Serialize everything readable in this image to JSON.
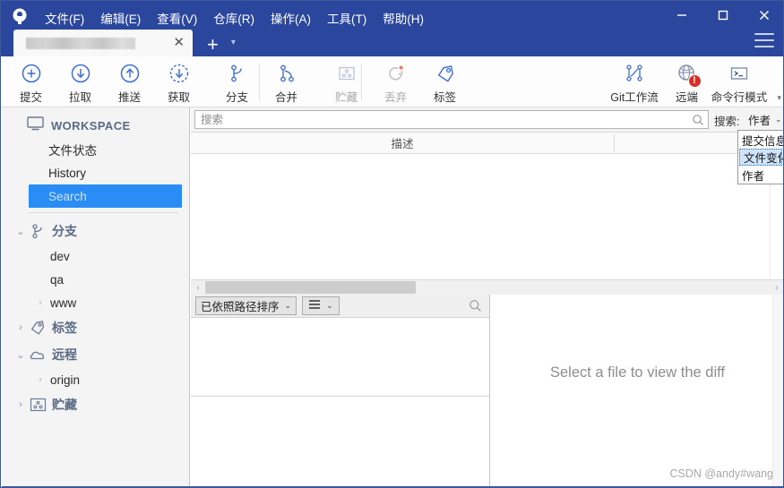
{
  "app": {
    "logo_icon": "sourcetree-logo-icon",
    "window_controls": {
      "minimize": "—",
      "maximize": "☐",
      "close": "✕"
    }
  },
  "menubar": {
    "items": [
      {
        "label": "文件(F)",
        "name": "menu-file"
      },
      {
        "label": "编辑(E)",
        "name": "menu-edit"
      },
      {
        "label": "查看(V)",
        "name": "menu-view"
      },
      {
        "label": "仓库(R)",
        "name": "menu-repository"
      },
      {
        "label": "操作(A)",
        "name": "menu-actions"
      },
      {
        "label": "工具(T)",
        "name": "menu-tools"
      },
      {
        "label": "帮助(H)",
        "name": "menu-help"
      }
    ]
  },
  "tabs": {
    "active_title": "",
    "close_label": "✕",
    "new_tab_label": "+",
    "tab_list_caret": "▾"
  },
  "toolbar": {
    "left_buttons": [
      {
        "label": "提交",
        "icon": "commit-plus-circle-icon",
        "disabled": false
      },
      {
        "label": "拉取",
        "icon": "pull-down-arrow-circle-icon",
        "disabled": false
      },
      {
        "label": "推送",
        "icon": "push-up-arrow-circle-icon",
        "disabled": false
      },
      {
        "label": "获取",
        "icon": "fetch-dashed-circle-icon",
        "disabled": false
      },
      {
        "label": "分支",
        "icon": "branch-icon",
        "disabled": false
      },
      {
        "label": "合并",
        "icon": "merge-icon",
        "disabled": false
      },
      {
        "label": "贮藏",
        "icon": "stash-box-icon",
        "disabled": true
      },
      {
        "label": "丢弃",
        "icon": "discard-refresh-icon",
        "disabled": true
      },
      {
        "label": "标签",
        "icon": "tag-icon",
        "disabled": false
      }
    ],
    "right_buttons": [
      {
        "label": "Git工作流",
        "icon": "gitflow-icon",
        "disabled": false,
        "badge": ""
      },
      {
        "label": "远端",
        "icon": "remote-globe-icon",
        "disabled": false,
        "badge": "!"
      },
      {
        "label": "命令行模式",
        "icon": "terminal-icon",
        "disabled": false,
        "badge": ""
      }
    ],
    "overflow_caret": "▾"
  },
  "sidebar": {
    "workspace": {
      "label": "WORKSPACE",
      "icon": "monitor-icon",
      "items": [
        {
          "label": "文件状态",
          "name": "sidebar-item-file-status",
          "selected": false
        },
        {
          "label": "History",
          "name": "sidebar-item-history",
          "selected": false
        },
        {
          "label": "Search",
          "name": "sidebar-item-search",
          "selected": true
        }
      ]
    },
    "groups": [
      {
        "label": "分支",
        "icon": "branch-icon",
        "name": "sidebar-group-branches",
        "expanded": true,
        "chevron": "⌄",
        "children": [
          {
            "label": "dev",
            "has_chevron": false
          },
          {
            "label": "qa",
            "has_chevron": false
          },
          {
            "label": "www",
            "has_chevron": true
          }
        ]
      },
      {
        "label": "标签",
        "icon": "tag-icon",
        "name": "sidebar-group-tags",
        "expanded": false,
        "chevron": "›",
        "children": []
      },
      {
        "label": "远程",
        "icon": "cloud-icon",
        "name": "sidebar-group-remotes",
        "expanded": true,
        "chevron": "⌄",
        "children": [
          {
            "label": "origin",
            "has_chevron": true
          }
        ]
      },
      {
        "label": "贮藏",
        "icon": "stash-box-icon",
        "name": "sidebar-group-stashes",
        "expanded": false,
        "chevron": "›",
        "children": []
      }
    ]
  },
  "search": {
    "placeholder": "搜索",
    "value": "",
    "icon": "search-icon",
    "label": "搜索:",
    "selected_option": "作者",
    "caret": "⌄",
    "options": [
      {
        "label": "提交信息",
        "active": false
      },
      {
        "label": "文件变化",
        "active": true
      },
      {
        "label": "作者",
        "active": false
      }
    ]
  },
  "commit_table": {
    "columns": [
      {
        "label": "描述",
        "name": "column-description"
      },
      {
        "label": "",
        "name": "column-extra"
      }
    ],
    "rows": [],
    "vscroll_arrow": "⌄",
    "hscroll_left_arrow": "‹",
    "hscroll_right_arrow": "›"
  },
  "file_panel": {
    "sort_combo": {
      "label": "已依照路径排序",
      "caret": "⌄",
      "name": "sort-by-path-combo"
    },
    "view_combo": {
      "icon": "list-view-icon",
      "caret": "⌄",
      "name": "view-mode-combo"
    },
    "search_icon": "search-icon",
    "files": []
  },
  "diff_panel": {
    "empty_message": "Select a file to view the diff"
  },
  "watermark": {
    "text": "CSDN @andy#wang"
  },
  "colors": {
    "titlebar": "#2b479d",
    "accent_blue": "#3f6fd0",
    "selection_blue": "#2a8cf5",
    "badge_red": "#d93025",
    "sidebar_bg": "#f4f4f4",
    "group_label": "#5a6a85"
  }
}
